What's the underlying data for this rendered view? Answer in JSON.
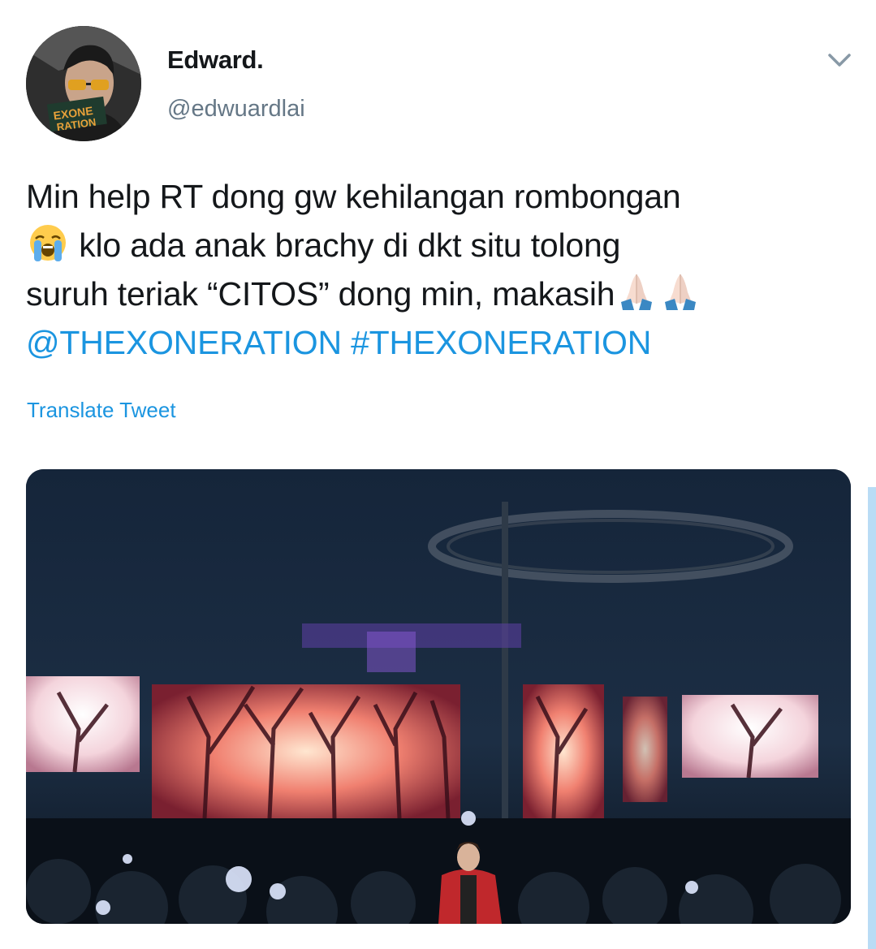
{
  "tweet": {
    "author": {
      "display_name": "Edward.",
      "handle": "@edwuardlai",
      "avatar_icon": "profile-photo"
    },
    "text": {
      "line1": "Min help RT dong gw kehilangan rombongan",
      "line2_emoji": "loudly-crying-face-emoji",
      "line2": " klo ada anak brachy di dkt situ tolong",
      "line3": "suruh teriak “CITOS” dong min, makasih",
      "line3_emojis": [
        "folded-hands-emoji",
        "folded-hands-emoji"
      ],
      "mention": "@THEXONERATION",
      "hashtag": "#THEXONERATION"
    },
    "translate_label": "Translate Tweet",
    "menu_icon": "chevron-down-icon",
    "media": {
      "kind": "photo",
      "icon": "concert-stage-photo"
    }
  },
  "colors": {
    "text": "#14171a",
    "secondary": "#657786",
    "link": "#1b95e0",
    "background": "#ffffff"
  }
}
